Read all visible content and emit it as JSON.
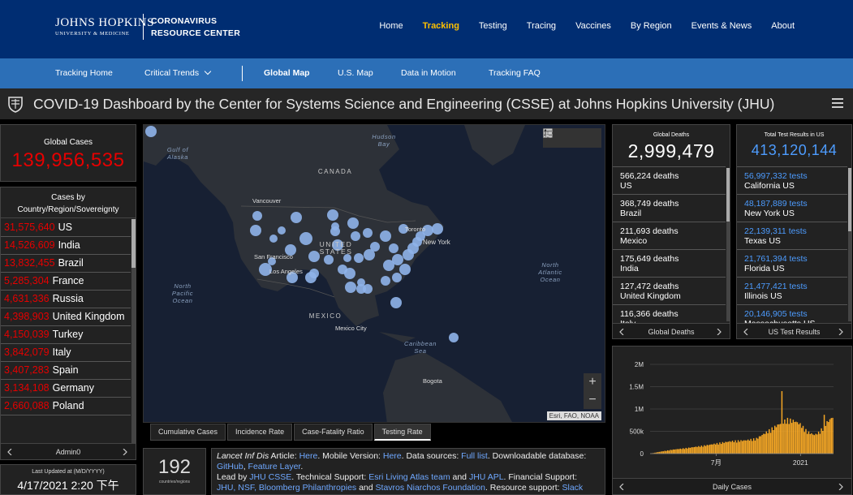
{
  "header": {
    "logo_line1": "JOHNS HOPKINS",
    "logo_line2": "UNIVERSITY & MEDICINE",
    "logo_crc_line1": "CORONAVIRUS",
    "logo_crc_line2": "RESOURCE CENTER",
    "nav": [
      "Home",
      "Tracking",
      "Testing",
      "Tracing",
      "Vaccines",
      "By Region",
      "Events & News",
      "About"
    ],
    "nav_active_index": 1
  },
  "subnav": {
    "tracking_home": "Tracking Home",
    "critical_trends": "Critical Trends",
    "global_map": "Global Map",
    "us_map": "U.S. Map",
    "data_in_motion": "Data in Motion",
    "tracking_faq": "Tracking FAQ"
  },
  "dashboard": {
    "title": "COVID-19 Dashboard by the Center for Systems Science and Engineering (CSSE) at Johns Hopkins University (JHU)"
  },
  "global_cases": {
    "label": "Global Cases",
    "value": "139,956,535"
  },
  "cases_by_country": {
    "header_line1": "Cases by",
    "header_line2": "Country/Region/Sovereignty",
    "rows": [
      {
        "num": "31,575,640",
        "name": "US"
      },
      {
        "num": "14,526,609",
        "name": "India"
      },
      {
        "num": "13,832,455",
        "name": "Brazil"
      },
      {
        "num": "5,285,304",
        "name": "France"
      },
      {
        "num": "4,631,336",
        "name": "Russia"
      },
      {
        "num": "4,398,903",
        "name": "United Kingdom"
      },
      {
        "num": "4,150,039",
        "name": "Turkey"
      },
      {
        "num": "3,842,079",
        "name": "Italy"
      },
      {
        "num": "3,407,283",
        "name": "Spain"
      },
      {
        "num": "3,134,108",
        "name": "Germany"
      },
      {
        "num": "2,660,088",
        "name": "Poland"
      }
    ],
    "footer": "Admin0"
  },
  "last_updated": {
    "label": "Last Updated at (M/D/YYYY)",
    "value": "4/17/2021 2:20 下午"
  },
  "map": {
    "labels": {
      "gulf_alaska": "Gulf of\nAlaska",
      "hudson_bay": "Hudson\nBay",
      "canada": "CANADA",
      "united_states": "UNITED\nSTATES",
      "mexico": "MEXICO",
      "north_pacific": "North\nPacific\nOcean",
      "north_atlantic": "North\nAtlantic\nOcean",
      "caribbean": "Caribbean\nSea",
      "vancouver": "Vancouver",
      "toronto": "Toronto",
      "new_york": "New York",
      "san_francisco": "San Francisco",
      "los_angeles": "Los Angeles",
      "mexico_city": "Mexico City",
      "bogota": "Bogota"
    },
    "zoom_in": "+",
    "zoom_out": "−",
    "attribution": "Esri, FAO, NOAA",
    "tabs": [
      "Cumulative Cases",
      "Incidence Rate",
      "Case-Fatality Ratio",
      "Testing Rate"
    ],
    "active_tab_index": 3
  },
  "countries_count": {
    "value": "192",
    "label": "countries/regions"
  },
  "info": {
    "journal": "Lancet Inf Dis",
    "article_label": " Article: ",
    "here1": "Here",
    "mobile_label": ". Mobile Version: ",
    "here2": "Here",
    "sources_label": ". Data sources: ",
    "full_list": "Full list",
    "download_label": ". Downloadable database:",
    "github": "GitHub",
    "comma": ", ",
    "feature_layer": "Feature Layer",
    "period": ".",
    "lead_by": "Lead by ",
    "jhu_csse": "JHU CSSE",
    "tech_support": ". Technical Support: ",
    "esri_team": "Esri Living Atlas team",
    "and1": " and ",
    "jhu_apl": "JHU APL",
    "fin_support": ". Financial Support:",
    "jhu_nsf": "JHU, NSF, Bloomberg Philanthropies",
    "and2": " and ",
    "stavros": "Stavros Niarchos Foundation",
    "resource_support": ". Resource support: ",
    "slack": "Slack"
  },
  "global_deaths": {
    "label": "Global Deaths",
    "value": "2,999,479",
    "rows": [
      {
        "num": "566,224 deaths",
        "name": "US"
      },
      {
        "num": "368,749 deaths",
        "name": "Brazil"
      },
      {
        "num": "211,693 deaths",
        "name": "Mexico"
      },
      {
        "num": "175,649 deaths",
        "name": "India"
      },
      {
        "num": "127,472 deaths",
        "name": "United Kingdom"
      },
      {
        "num": "116,366 deaths",
        "name": "Italy"
      }
    ],
    "footer": "Global Deaths"
  },
  "us_tests": {
    "label": "Total Test Results in US",
    "value": "413,120,144",
    "rows": [
      {
        "num": "56,997,332 tests",
        "name": "California US"
      },
      {
        "num": "48,187,889 tests",
        "name": "New York US"
      },
      {
        "num": "22,139,311 tests",
        "name": "Texas US"
      },
      {
        "num": "21,761,394 tests",
        "name": "Florida US"
      },
      {
        "num": "21,477,421 tests",
        "name": "Illinois US"
      },
      {
        "num": "20,146,905 tests",
        "name": "Massachusetts US"
      }
    ],
    "footer": "US Test Results"
  },
  "chart_data": {
    "type": "bar",
    "title": "",
    "footer": "Daily Cases",
    "ylim": [
      0,
      2000000
    ],
    "yticks": [
      0,
      500000,
      1000000,
      1500000,
      2000000
    ],
    "ytick_labels": [
      "0",
      "500k",
      "1M",
      "1.5M",
      "2M"
    ],
    "xtick_labels": [
      "7月",
      "2021"
    ],
    "xtick_positions": [
      0.36,
      0.82
    ],
    "bar_color": "#f7a825",
    "grid": true,
    "anchors": [
      [
        0.0,
        2000
      ],
      [
        0.05,
        40000
      ],
      [
        0.12,
        85000
      ],
      [
        0.2,
        120000
      ],
      [
        0.3,
        175000
      ],
      [
        0.36,
        215000
      ],
      [
        0.44,
        265000
      ],
      [
        0.52,
        285000
      ],
      [
        0.58,
        320000
      ],
      [
        0.64,
        470000
      ],
      [
        0.7,
        620000
      ],
      [
        0.75,
        730000
      ],
      [
        0.79,
        700000
      ],
      [
        0.82,
        640000
      ],
      [
        0.86,
        470000
      ],
      [
        0.9,
        400000
      ],
      [
        0.93,
        470000
      ],
      [
        0.96,
        640000
      ],
      [
        1.0,
        790000
      ]
    ],
    "spikes": [
      [
        0.72,
        1400000
      ],
      [
        0.955,
        870000
      ]
    ]
  },
  "colors": {
    "header_blue": "#002d72",
    "subnav_blue": "#2c6fb7",
    "nav_active": "#ffc000",
    "cases_red": "#e60000",
    "tests_blue": "#4d9cff",
    "map_bubble": "#8fb4ea"
  }
}
